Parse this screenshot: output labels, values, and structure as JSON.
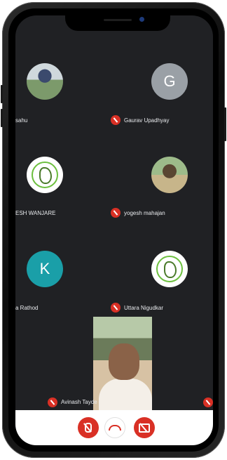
{
  "participants": [
    {
      "label": "sahu",
      "tile": "photo",
      "muted": false
    },
    {
      "label": "Gaurav Upadhyay",
      "tile": "letter",
      "initial": "G",
      "avatar_color": "#9aa0a6",
      "muted": true
    },
    {
      "label": "ESH WANJARE",
      "tile": "logo",
      "muted": false
    },
    {
      "label": "yogesh mahajan",
      "tile": "photo",
      "muted": true
    },
    {
      "label": "a Rathod",
      "tile": "letter",
      "initial": "K",
      "avatar_color": "#1a9fa8",
      "muted": false
    },
    {
      "label": "Uttara Nigudkar",
      "tile": "logo",
      "muted": true
    },
    {
      "label": "Avinash Tayde",
      "tile": "video",
      "muted": true
    }
  ],
  "controls": {
    "mic": {
      "icon": "mic-off-icon",
      "color": "#d93025"
    },
    "end_call": {
      "icon": "phone-hangup-icon",
      "color": "#d93025"
    },
    "camera": {
      "icon": "camera-off-icon",
      "color": "#d93025"
    }
  },
  "colors": {
    "screen_bg": "#202124",
    "muted_badge": "#d93025"
  }
}
